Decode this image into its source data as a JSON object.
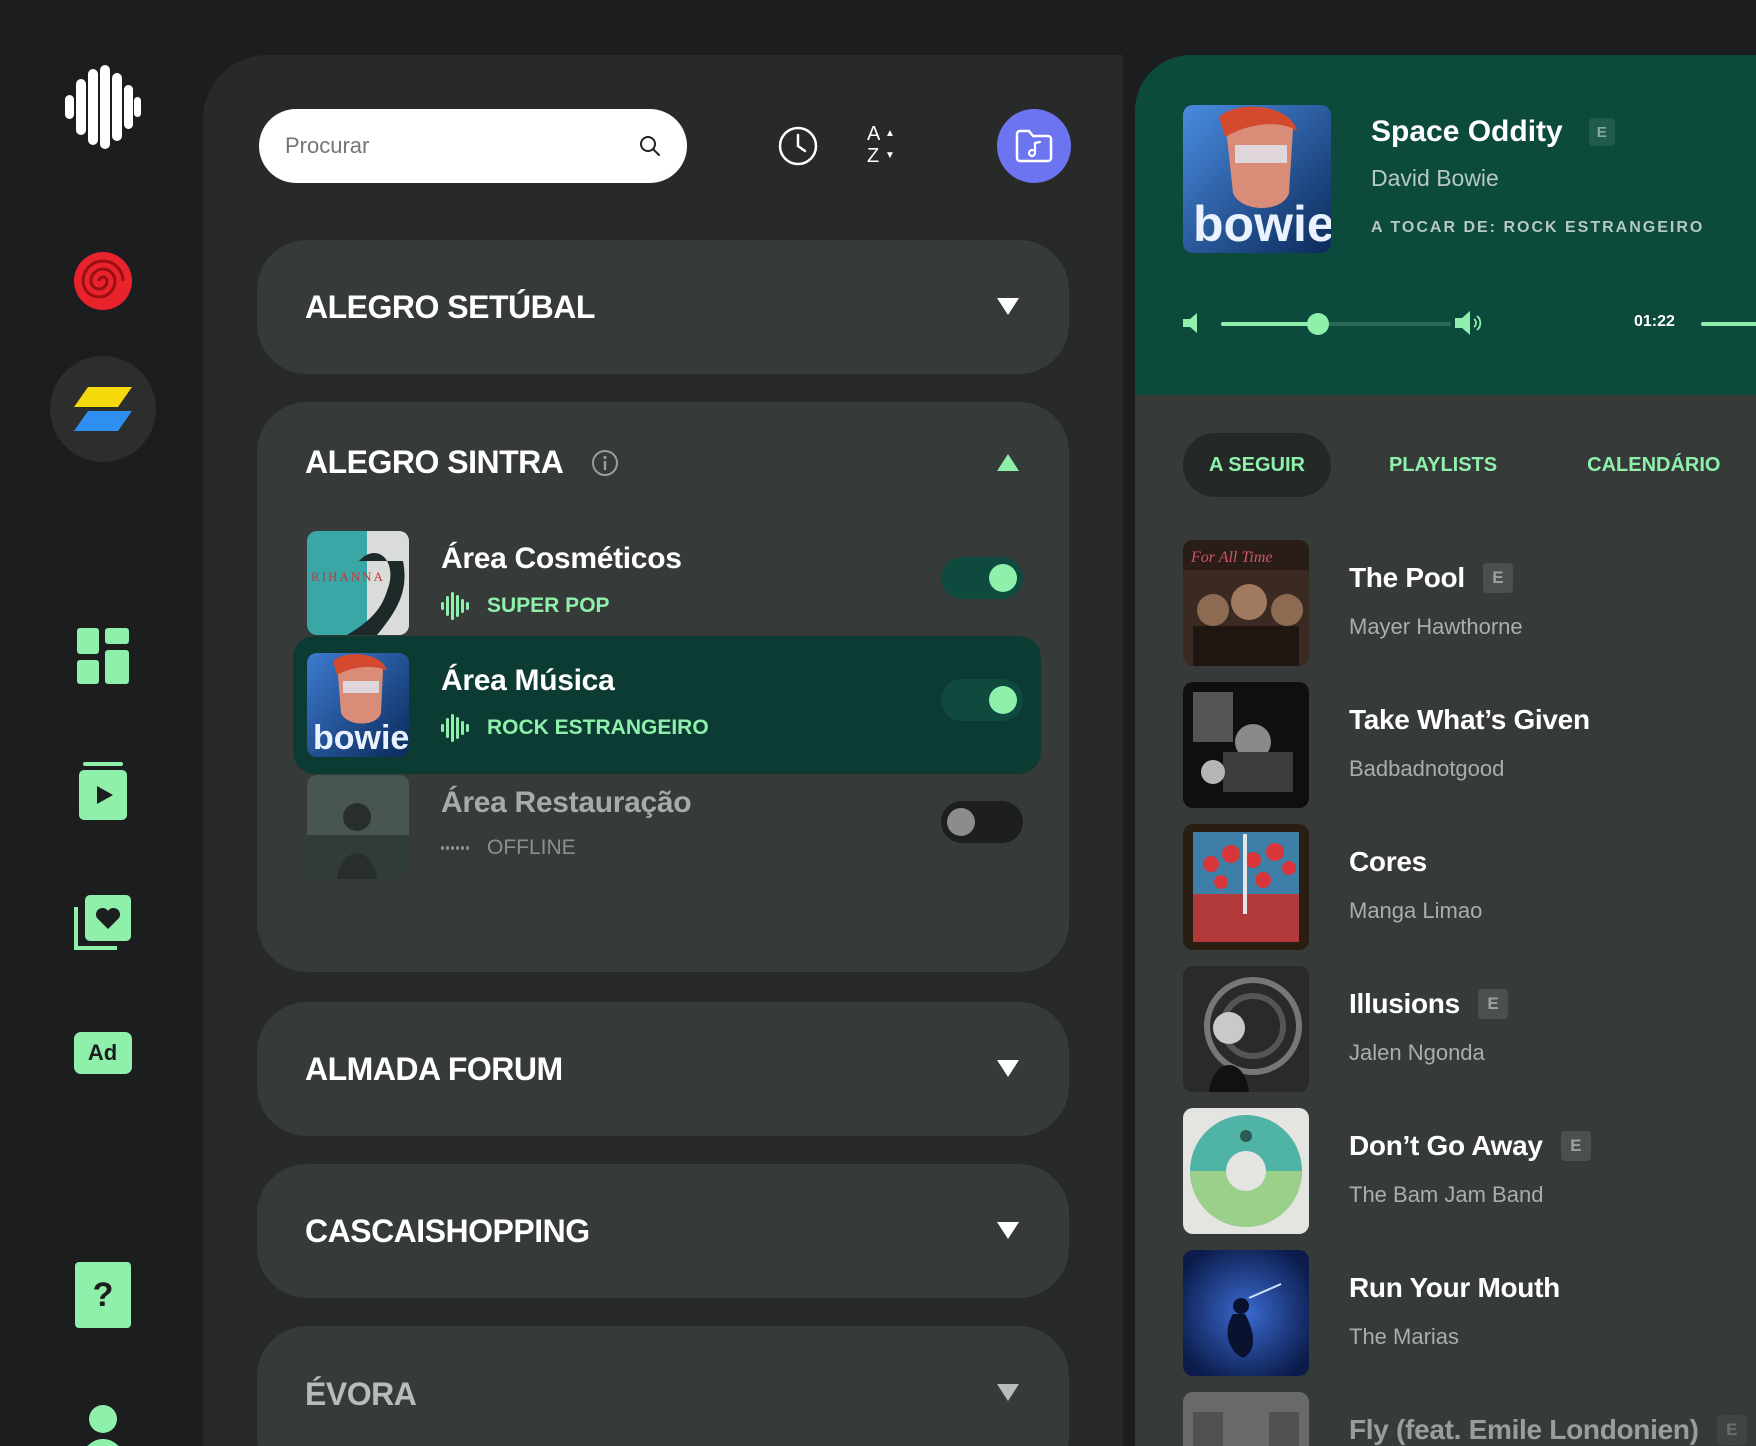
{
  "colors": {
    "accent": "#8ff0ac",
    "panel": "#282a29",
    "card": "#363b39",
    "now_playing_bg": "#0c4a3c",
    "folder_button": "#6d74f0"
  },
  "sidebar": {
    "items": [
      {
        "icon": "brand-waveform-icon"
      },
      {
        "icon": "spiral-icon"
      },
      {
        "icon": "lightning-icon",
        "active": true
      },
      {
        "icon": "dashboard-grid-icon"
      },
      {
        "icon": "playlist-play-icon"
      },
      {
        "icon": "favorites-heart-icon"
      },
      {
        "icon": "ad-icon",
        "label": "Ad"
      },
      {
        "icon": "help-ticket-icon",
        "label": "?"
      },
      {
        "icon": "user-icon"
      }
    ]
  },
  "toolbar": {
    "search_placeholder": "Procurar",
    "history_icon": "clock-icon",
    "sort_top": "A",
    "sort_bottom": "Z",
    "folder_icon": "music-folder-icon"
  },
  "locations": [
    {
      "name": "ALEGRO SETÚBAL",
      "expanded": false
    },
    {
      "name": "ALEGRO SINTRA",
      "expanded": true,
      "zones": [
        {
          "name": "Área Cosméticos",
          "playlist": "SUPER POP",
          "enabled": true,
          "active": false
        },
        {
          "name": "Área Música",
          "playlist": "ROCK ESTRANGEIRO",
          "enabled": true,
          "active": true
        },
        {
          "name": "Área Restauração",
          "playlist": "OFFLINE",
          "enabled": false,
          "active": false
        }
      ]
    },
    {
      "name": "ALMADA FORUM",
      "expanded": false
    },
    {
      "name": "CASCAISHOPPING",
      "expanded": false
    },
    {
      "name": "ÉVORA",
      "expanded": false
    }
  ],
  "now_playing": {
    "title": "Space Oddity",
    "explicit": "E",
    "artist": "David Bowie",
    "source": "A TOCAR DE: ROCK ESTRANGEIRO",
    "art_text": "bowie",
    "volume": 0.42,
    "time": "01:22"
  },
  "tabs": [
    "A SEGUIR",
    "PLAYLISTS",
    "CALENDÁRIO"
  ],
  "queue": [
    {
      "title": "The Pool",
      "artist": "Mayer Hawthorne",
      "explicit": "E"
    },
    {
      "title": "Take What’s Given",
      "artist": "Badbadnotgood",
      "explicit": ""
    },
    {
      "title": "Cores",
      "artist": "Manga Limao",
      "explicit": ""
    },
    {
      "title": "Illusions",
      "artist": "Jalen Ngonda",
      "explicit": "E"
    },
    {
      "title": "Don’t Go Away",
      "artist": "The Bam Jam Band",
      "explicit": "E"
    },
    {
      "title": "Run Your Mouth",
      "artist": "The Marias",
      "explicit": ""
    },
    {
      "title": "Fly (feat. Emile Londonien)",
      "artist": "",
      "explicit": "E"
    }
  ]
}
